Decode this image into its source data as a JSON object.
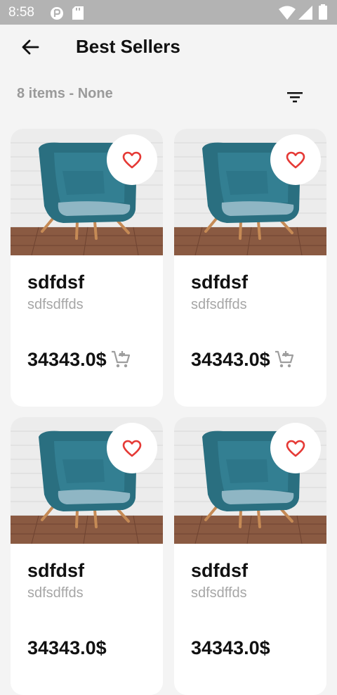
{
  "status_bar": {
    "time": "8:58"
  },
  "header": {
    "title": "Best Sellers"
  },
  "subheader": {
    "summary": "8 items - None"
  },
  "products": [
    {
      "name": "sdfdsf",
      "description": "sdfsdffds",
      "price": "34343.0$"
    },
    {
      "name": "sdfdsf",
      "description": "sdfsdffds",
      "price": "34343.0$"
    },
    {
      "name": "sdfdsf",
      "description": "sdfsdffds",
      "price": "34343.0$"
    },
    {
      "name": "sdfdsf",
      "description": "sdfsdffds",
      "price": "34343.0$"
    }
  ],
  "icons": {
    "back": "arrow-left-icon",
    "filter": "filter-icon",
    "favorite": "heart-outline-icon",
    "cart": "add-to-cart-icon"
  },
  "colors": {
    "accent": "#e53935",
    "status_bar": "#b3b3b3",
    "background": "#f4f4f4",
    "chair": "#2f7a8c"
  }
}
